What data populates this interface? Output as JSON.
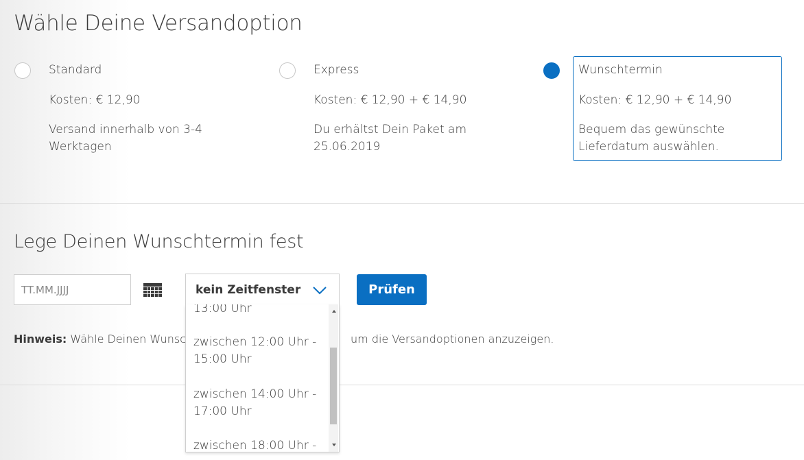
{
  "shipping": {
    "title": "Wähle Deine Versandoption",
    "options": [
      {
        "name": "Standard",
        "cost": "Kosten: € 12,90",
        "desc": "Versand innerhalb von 3-4 Werktagen",
        "selected": false
      },
      {
        "name": "Express",
        "cost": "Kosten: € 12,90 + € 14,90",
        "desc": "Du erhältst Dein Paket am 25.06.2019",
        "selected": false
      },
      {
        "name": "Wunschtermin",
        "cost": "Kosten: € 12,90 + € 14,90",
        "desc": "Bequem das gewünschte Lieferdatum auswählen.",
        "selected": true
      }
    ]
  },
  "appointment": {
    "title": "Lege Deinen Wunschtermin fest",
    "date_placeholder": "TT.MM.JJJJ",
    "time_select": "kein Zeitfenster",
    "check_button": "Prüfen",
    "hint_label": "Hinweis:",
    "hint_text_start": " Wähle Deinen Wunsc",
    "hint_text_end": "um die Versandoptionen anzuzeigen.",
    "time_options": [
      "13:00 Uhr",
      "zwischen 12:00 Uhr - 15:00 Uhr",
      "zwischen 14:00 Uhr - 17:00 Uhr",
      "zwischen 18:00 Uhr -"
    ]
  },
  "colors": {
    "accent": "#0a6fc2"
  },
  "icons": {
    "calendar": "calendar-icon",
    "chevron": "chevron-down-icon"
  }
}
